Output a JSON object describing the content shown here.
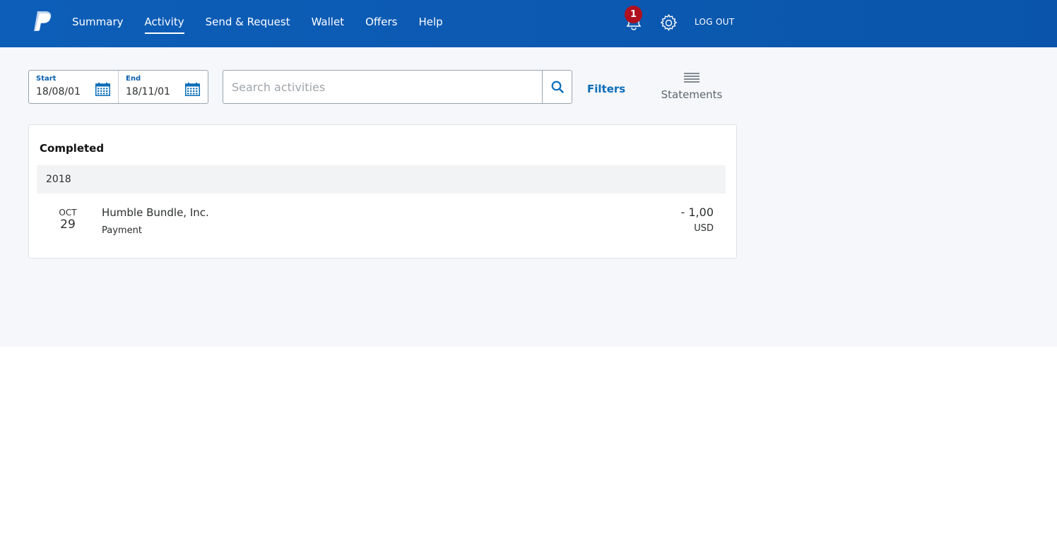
{
  "nav": {
    "items": [
      {
        "label": "Summary"
      },
      {
        "label": "Activity"
      },
      {
        "label": "Send & Request"
      },
      {
        "label": "Wallet"
      },
      {
        "label": "Offers"
      },
      {
        "label": "Help"
      }
    ],
    "active": "Activity",
    "notifications_count": "1",
    "logout_label": "LOG OUT"
  },
  "filters": {
    "start_label": "Start",
    "start_value": "18/08/01",
    "end_label": "End",
    "end_value": "18/11/01",
    "search_placeholder": "Search activities",
    "filters_label": "Filters",
    "statements_label": "Statements"
  },
  "activity": {
    "section_title": "Completed",
    "year": "2018",
    "transactions": [
      {
        "month": "OCT",
        "day": "29",
        "name": "Humble Bundle, Inc.",
        "type": "Payment",
        "amount": "- 1,00",
        "currency": "USD"
      }
    ]
  },
  "colors": {
    "header_blue": "#0d5eb8",
    "link_blue": "#0a6cb8",
    "badge_red": "#b0101e",
    "page_bg": "#f5f7fa"
  },
  "icons": [
    "paypal-logo",
    "bell-icon",
    "gear-icon",
    "calendar-icon",
    "search-icon",
    "statements-icon"
  ]
}
